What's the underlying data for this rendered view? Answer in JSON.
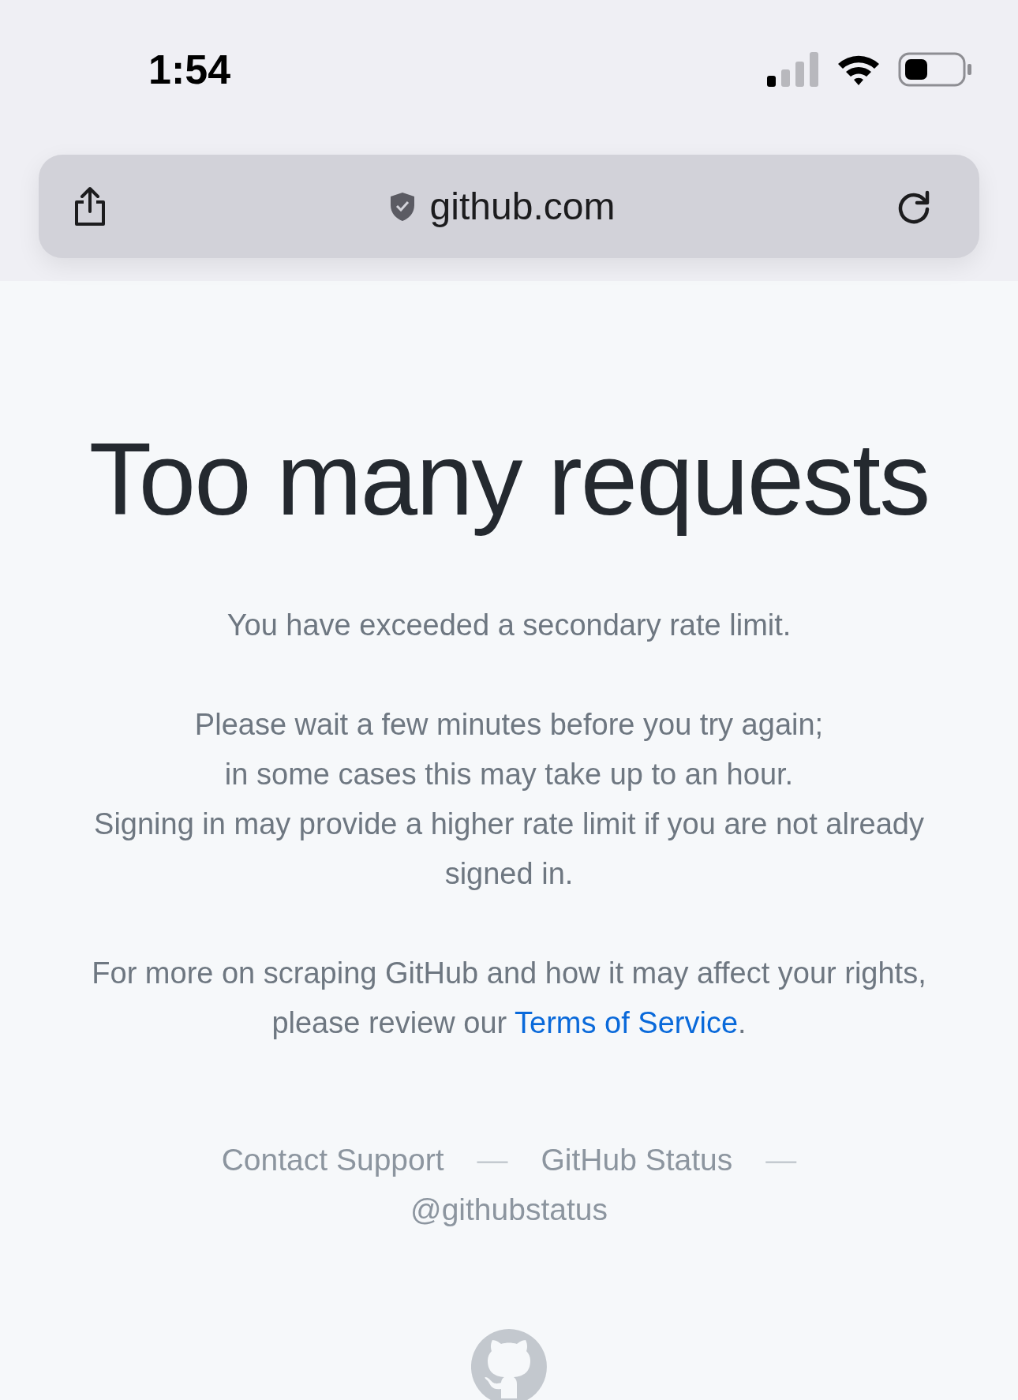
{
  "status_bar": {
    "time": "1:54"
  },
  "address_bar": {
    "url": "github.com"
  },
  "heading": "Too many requests",
  "paragraphs": [
    {
      "lines": [
        "You have exceeded a secondary rate limit."
      ]
    },
    {
      "lines": [
        "Please wait a few minutes before you try again;",
        "in some cases this may take up to an hour.",
        "Signing in may provide a higher rate limit if you are not already signed in."
      ]
    }
  ],
  "terms": {
    "text": "For more on scraping GitHub and how it may affect your rights, please review our ",
    "link": "Terms of Service",
    "tail": "."
  },
  "footer": [
    {
      "kind": "link",
      "text": "Contact Support"
    },
    {
      "kind": "separator",
      "text": "—"
    },
    {
      "kind": "link",
      "text": "GitHub Status"
    },
    {
      "kind": "separator",
      "text": "—"
    },
    {
      "kind": "link",
      "text": "@githubstatus"
    }
  ]
}
